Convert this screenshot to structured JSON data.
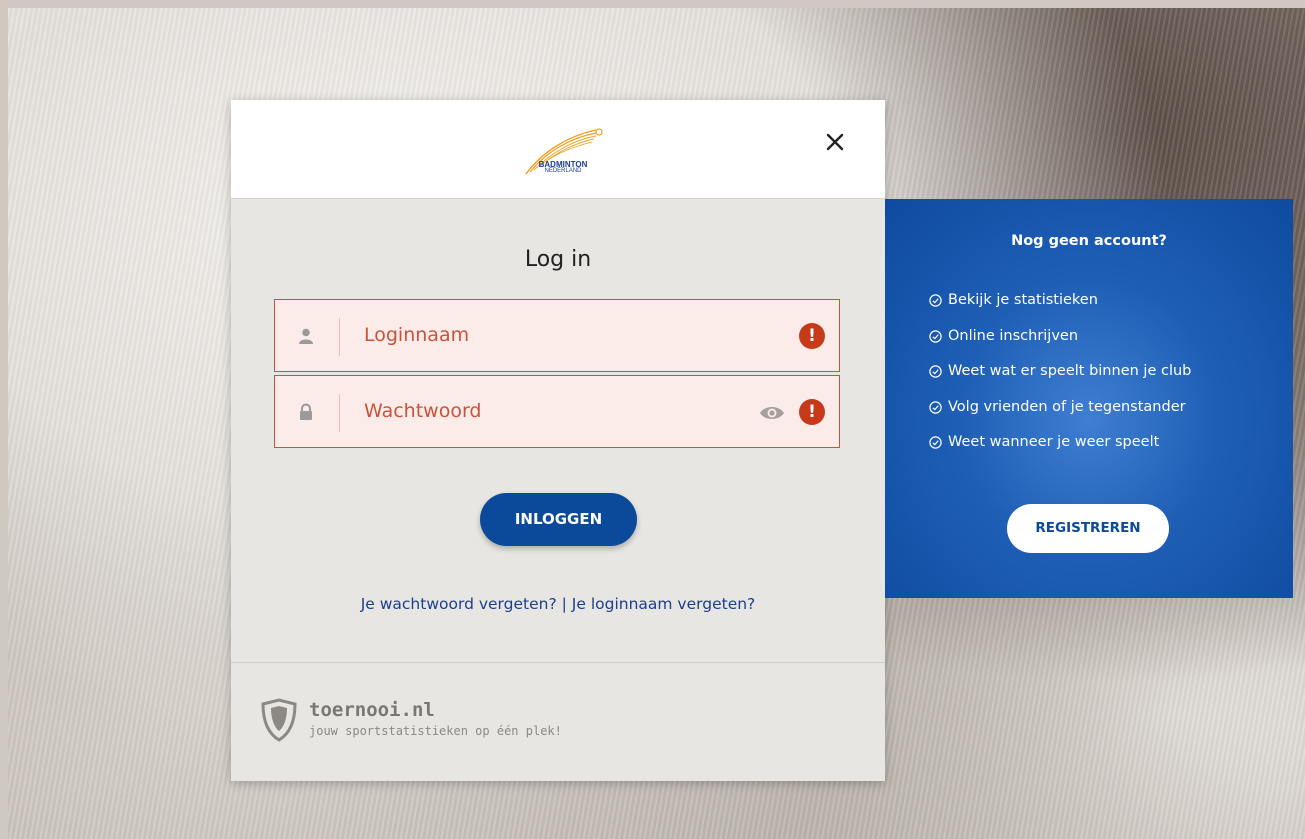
{
  "login": {
    "logo_line1": "BADMINTON",
    "logo_line2": "NEDERLAND",
    "title": "Log in",
    "username_placeholder": "Loginnaam",
    "password_placeholder": "Wachtwoord",
    "error_mark": "!",
    "submit_label": "INLOGGEN",
    "forgot_password": "Je wachtwoord vergeten?",
    "separator": "|",
    "forgot_username": "Je loginnaam vergeten?",
    "brand_name": "toernooi.nl",
    "brand_tagline": "jouw sportstatistieken op één plek!"
  },
  "signup": {
    "title": "Nog geen account?",
    "benefits": [
      "Bekijk je statistieken",
      "Online inschrijven",
      "Weet wat er speelt binnen je club",
      "Volg vrienden of je tegenstander",
      "Weet wanneer je weer speelt"
    ],
    "register_label": "REGISTREREN"
  },
  "colors": {
    "primary": "#0b4a9a",
    "error": "#c73a19",
    "field_bg": "#fbecea",
    "modal_bg": "#e8e6e2"
  },
  "icons": [
    "close-icon",
    "user-icon",
    "lock-icon",
    "eye-icon",
    "error-icon",
    "check-circle-icon",
    "shield-icon",
    "shuttlecock-logo"
  ]
}
